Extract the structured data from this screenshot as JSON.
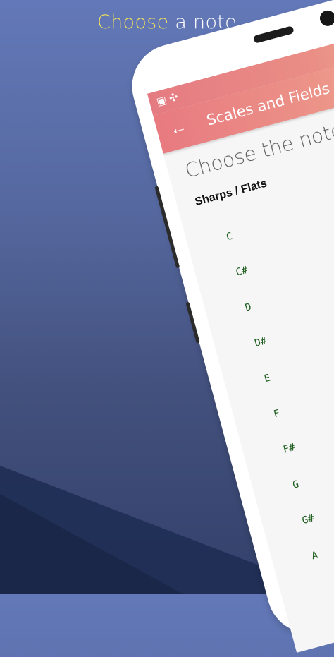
{
  "headline": {
    "accent": "Choose",
    "rest": " a note"
  },
  "statusbar": {
    "left_icons": "▣ ✣",
    "right_icons": "▯ ◷"
  },
  "appbar": {
    "back_icon": "←",
    "title": "Scales and Fields"
  },
  "content": {
    "title": "Choose the note",
    "toggle_on": true,
    "subheading": "Sharps / Flats",
    "notes": [
      "C",
      "C#",
      "D",
      "D#",
      "E",
      "F",
      "F#",
      "G",
      "G#",
      "A"
    ]
  },
  "colors": {
    "accent_yellow": "#f1e15b",
    "appbar_start": "#e87a80",
    "appbar_end": "#f2b597",
    "toggle": "#d746e3",
    "note_text": "#1f5e1f"
  }
}
